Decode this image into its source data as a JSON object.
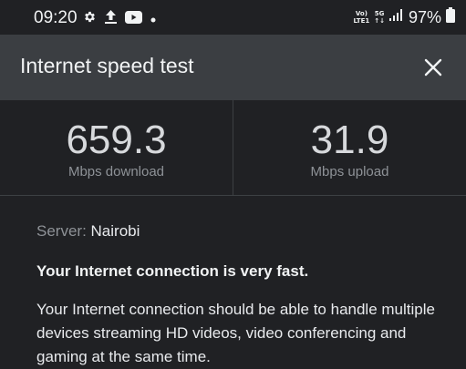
{
  "status_bar": {
    "time": "09:20",
    "left_icons": [
      "gear-icon",
      "upload-icon",
      "youtube-icon",
      "dot-icon"
    ],
    "network_tag_top": "Vo)",
    "network_tag_bottom": "LTE1",
    "network_5g_top": "5G",
    "network_5g_bottom": "↑↓",
    "battery_percent": "97%"
  },
  "header": {
    "title": "Internet speed test",
    "close_icon": "close-icon"
  },
  "results": {
    "download_value": "659.3",
    "download_label": "Mbps download",
    "upload_value": "31.9",
    "upload_label": "Mbps upload"
  },
  "details": {
    "server_label": "Server: ",
    "server_name": "Nairobi",
    "verdict": "Your Internet connection is very fast.",
    "description": "Your Internet connection should be able to handle multiple devices streaming HD videos, video conferencing and gaming at the same time."
  },
  "colors": {
    "background": "#202124",
    "header": "#3b3e42",
    "muted_text": "#8e9297"
  }
}
